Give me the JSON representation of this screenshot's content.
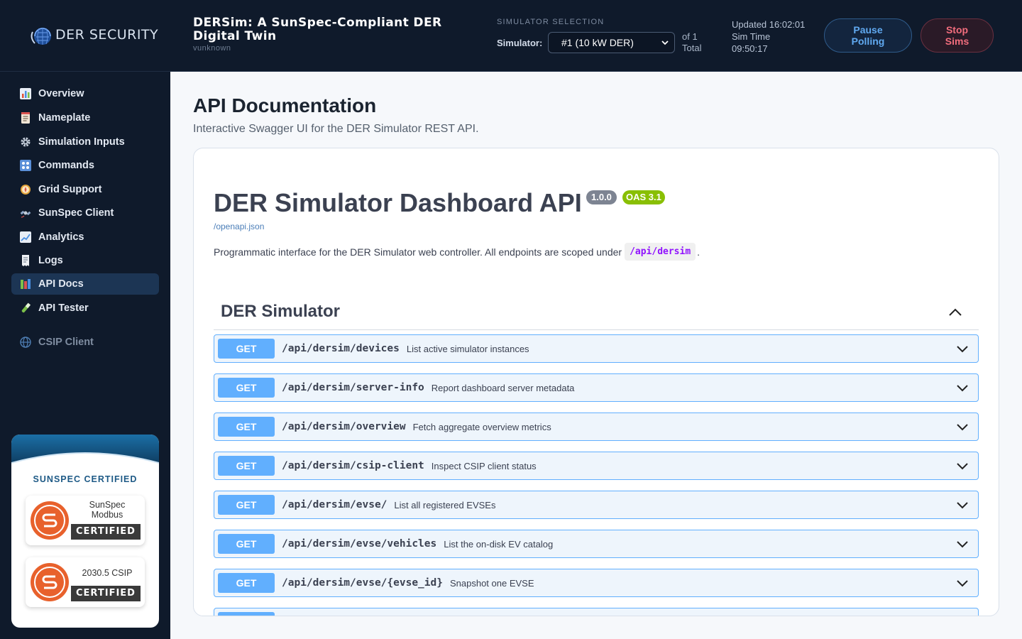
{
  "header": {
    "logo_text": "DER SECURITY",
    "title": "DERSim: A SunSpec-Compliant DER Digital Twin",
    "version": "vunknown",
    "sim_selection_label": "SIMULATOR SELECTION",
    "simulator_label": "Simulator:",
    "simulator_value": "#1 (10 kW DER)",
    "count_line1": "of 1",
    "count_line2": "Total",
    "updated": "Updated 16:02:01",
    "sim_time_label": "Sim Time",
    "sim_time": "09:50:17",
    "pause_button": [
      "Pause",
      "Polling"
    ],
    "stop_button": [
      "Stop",
      "Sims"
    ]
  },
  "sidebar": {
    "items": [
      {
        "label": "Overview",
        "icon": "bar-chart-icon"
      },
      {
        "label": "Nameplate",
        "icon": "nameplate-icon"
      },
      {
        "label": "Simulation Inputs",
        "icon": "gear-icon"
      },
      {
        "label": "Commands",
        "icon": "control-knobs-icon"
      },
      {
        "label": "Grid Support",
        "icon": "compass-icon"
      },
      {
        "label": "SunSpec Client",
        "icon": "satellite-icon"
      },
      {
        "label": "Analytics",
        "icon": "trend-chart-icon"
      },
      {
        "label": "Logs",
        "icon": "receipt-icon"
      },
      {
        "label": "API Docs",
        "icon": "books-icon",
        "active": true
      },
      {
        "label": "API Tester",
        "icon": "test-tube-icon"
      },
      {
        "label": "CSIP Client",
        "icon": "globe-icon",
        "dim": true
      }
    ],
    "cert_title": "SUNSPEC CERTIFIED",
    "badges": [
      {
        "name_lines": [
          "SunSpec",
          "Modbus"
        ],
        "status": "CERTIFIED"
      },
      {
        "name_lines": [
          "2030.5 CSIP"
        ],
        "status": "CERTIFIED"
      }
    ]
  },
  "main": {
    "title": "API Documentation",
    "subtitle": "Interactive Swagger UI for the DER Simulator REST API.",
    "api_title": "DER Simulator Dashboard API",
    "version_badge": "1.0.0",
    "oas_badge": "OAS 3.1",
    "openapi_link": "/openapi.json",
    "description": "Programmatic interface for the DER Simulator web controller. All endpoints are scoped under",
    "description_code": "/api/dersim",
    "description_end": ".",
    "tag_name": "DER Simulator",
    "operations": [
      {
        "method": "GET",
        "path": "/api/dersim/devices",
        "summary": "List active simulator instances"
      },
      {
        "method": "GET",
        "path": "/api/dersim/server-info",
        "summary": "Report dashboard server metadata"
      },
      {
        "method": "GET",
        "path": "/api/dersim/overview",
        "summary": "Fetch aggregate overview metrics"
      },
      {
        "method": "GET",
        "path": "/api/dersim/csip-client",
        "summary": "Inspect CSIP client status"
      },
      {
        "method": "GET",
        "path": "/api/dersim/evse/",
        "summary": "List all registered EVSEs"
      },
      {
        "method": "GET",
        "path": "/api/dersim/evse/vehicles",
        "summary": "List the on-disk EV catalog"
      },
      {
        "method": "GET",
        "path": "/api/dersim/evse/{evse_id}",
        "summary": "Snapshot one EVSE"
      }
    ]
  },
  "colors": {
    "header_bg": "#0f1a2b",
    "get_method": "#61affe",
    "oas_green": "#89bf04",
    "stop_red": "#f26d7d",
    "pause_blue": "#60a9f0"
  }
}
